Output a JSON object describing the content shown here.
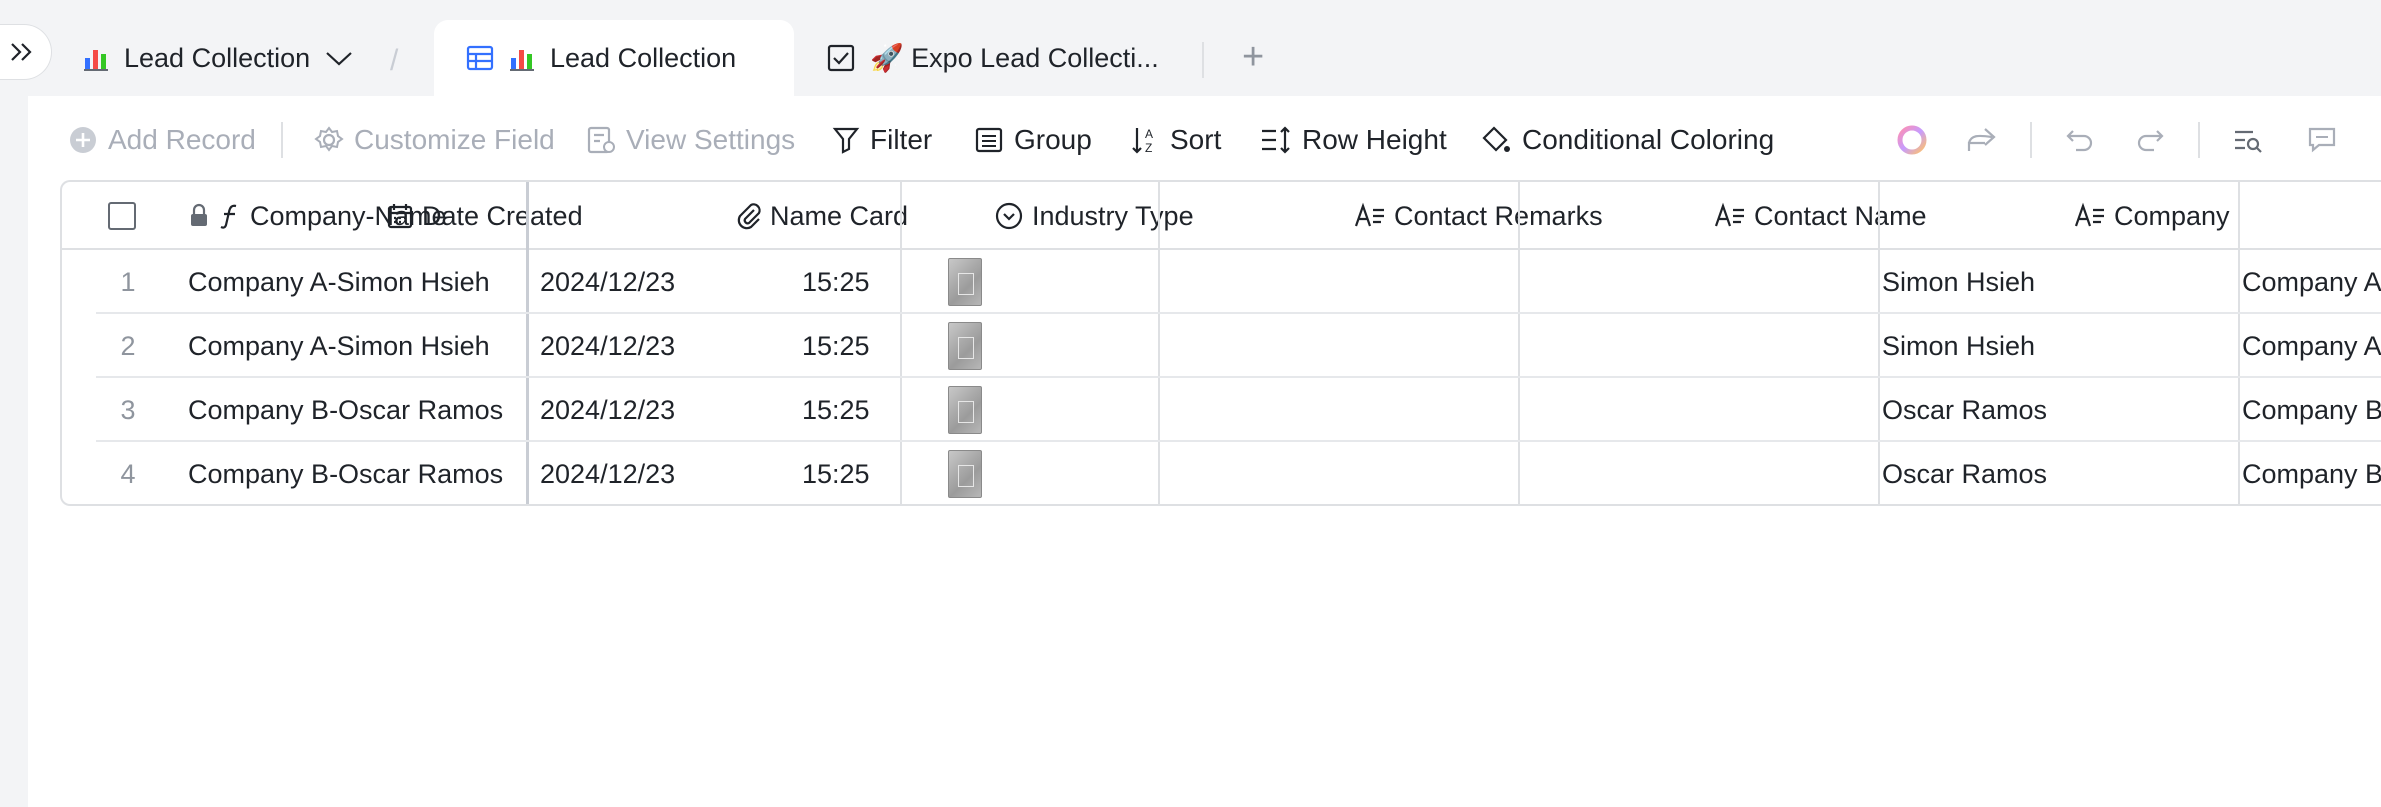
{
  "tabs": {
    "tab1_label": "Lead Collection",
    "tab2_label": "Lead Collection",
    "tab3_label": "🚀 Expo Lead Collecti...",
    "add_tab": "+"
  },
  "toolbar": {
    "add_record": "Add Record",
    "customize_field": "Customize Field",
    "view_settings": "View Settings",
    "filter": "Filter",
    "group": "Group",
    "sort": "Sort",
    "row_height": "Row Height",
    "conditional_coloring": "Conditional Coloring"
  },
  "columns": {
    "company_name": "Company-Name",
    "date_created": "Date Created",
    "name_card": "Name Card",
    "industry_type": "Industry Type",
    "contact_remarks": "Contact Remarks",
    "contact_name": "Contact Name",
    "company": "Company"
  },
  "rows": [
    {
      "num": "1",
      "company_name": "Company A-Simon Hsieh",
      "date": "2024/12/23",
      "time": "15:25",
      "industry": "",
      "remarks": "",
      "contact": "Simon Hsieh",
      "company": "Company A"
    },
    {
      "num": "2",
      "company_name": "Company A-Simon Hsieh",
      "date": "2024/12/23",
      "time": "15:25",
      "industry": "",
      "remarks": "",
      "contact": "Simon Hsieh",
      "company": "Company A"
    },
    {
      "num": "3",
      "company_name": "Company B-Oscar Ramos",
      "date": "2024/12/23",
      "time": "15:25",
      "industry": "",
      "remarks": "",
      "contact": "Oscar Ramos",
      "company": "Company B"
    },
    {
      "num": "4",
      "company_name": "Company B-Oscar Ramos",
      "date": "2024/12/23",
      "time": "15:25",
      "industry": "",
      "remarks": "",
      "contact": "Oscar Ramos",
      "company": "Company B"
    }
  ],
  "colors": {
    "accent": "#3370ff",
    "text": "#1f2329",
    "disabled": "#a9aeb8",
    "border": "#dee0e3"
  }
}
